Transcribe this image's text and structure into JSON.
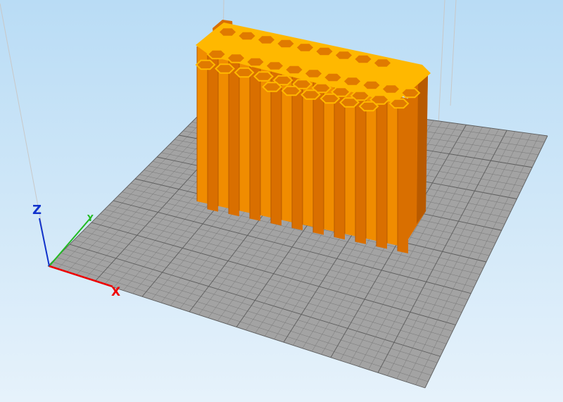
{
  "viewport": {
    "background_top": "#b9dcf5",
    "background_bottom": "#e6f2fb"
  },
  "bed": {
    "fill": "#a3a3a3",
    "grid_color": "#777777",
    "grid_major_color": "#5c5c5c"
  },
  "model": {
    "front_color": "#f08c00",
    "side_color": "#d96f00",
    "dark_color": "#b85a00",
    "top_color": "#ffb800",
    "hole_color": "#e07a00"
  },
  "axes": {
    "x": {
      "label": "X",
      "color": "#ee0000"
    },
    "y": {
      "label": "Y",
      "color": "#22bb22"
    },
    "z": {
      "label": "Z",
      "color": "#1133cc"
    }
  },
  "build_volume_line_color": "#c8c8c8"
}
